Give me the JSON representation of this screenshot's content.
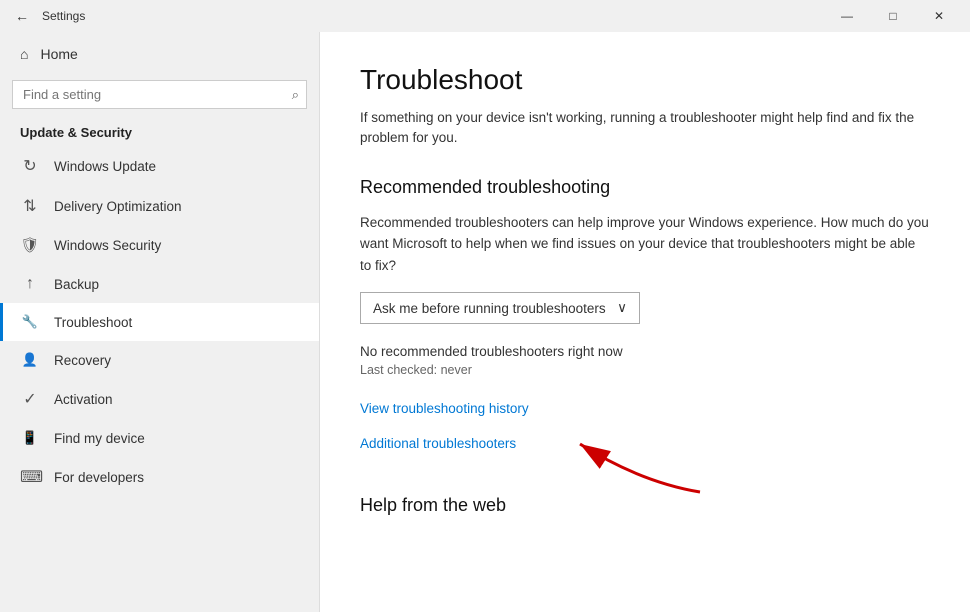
{
  "titleBar": {
    "title": "Settings",
    "backLabel": "←",
    "minimizeLabel": "—",
    "maximizeLabel": "□",
    "closeLabel": "✕"
  },
  "sidebar": {
    "homeLabel": "Home",
    "searchPlaceholder": "Find a setting",
    "sectionTitle": "Update & Security",
    "items": [
      {
        "id": "windows-update",
        "label": "Windows Update",
        "icon": "update"
      },
      {
        "id": "delivery-optimization",
        "label": "Delivery Optimization",
        "icon": "delivery"
      },
      {
        "id": "windows-security",
        "label": "Windows Security",
        "icon": "security"
      },
      {
        "id": "backup",
        "label": "Backup",
        "icon": "backup"
      },
      {
        "id": "troubleshoot",
        "label": "Troubleshoot",
        "icon": "troubleshoot",
        "active": true
      },
      {
        "id": "recovery",
        "label": "Recovery",
        "icon": "recovery"
      },
      {
        "id": "activation",
        "label": "Activation",
        "icon": "activation"
      },
      {
        "id": "find-my-device",
        "label": "Find my device",
        "icon": "finddevice"
      },
      {
        "id": "for-developers",
        "label": "For developers",
        "icon": "developers"
      }
    ]
  },
  "content": {
    "title": "Troubleshoot",
    "description": "If something on your device isn't working, running a troubleshooter might help find and fix the problem for you.",
    "recommendedSection": {
      "heading": "Recommended troubleshooting",
      "description": "Recommended troubleshooters can help improve your Windows experience. How much do you want Microsoft to help when we find issues on your device that troubleshooters might be able to fix?",
      "dropdownValue": "Ask me before running troubleshooters",
      "dropdownChevron": "∨",
      "noTroubleshootersText": "No recommended troubleshooters right now",
      "lastCheckedLabel": "Last checked: never"
    },
    "viewHistoryLink": "View troubleshooting history",
    "additionalLink": "Additional troubleshooters",
    "helpHeading": "Help from the web"
  }
}
